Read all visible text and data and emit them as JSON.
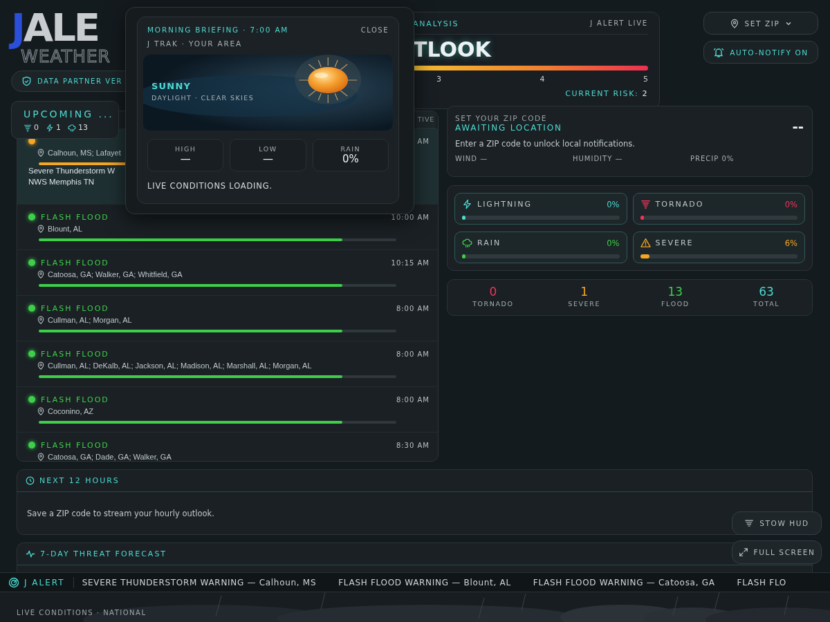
{
  "logo": {
    "initial": "J",
    "rest": "ALE",
    "subtitle": "WEATHER"
  },
  "partner_badge": {
    "label": "DATA PARTNER VER"
  },
  "risk_panel": {
    "title": "ANALYSIS",
    "source": "J ALERT LIVE",
    "heading": "TLOOK",
    "scale": [
      "3",
      "4",
      "5"
    ],
    "current_label": "CURRENT RISK:",
    "current_value": "2"
  },
  "header_buttons": [
    {
      "kind": "zip",
      "label": "SET ZIP",
      "on": false
    },
    {
      "kind": "notify",
      "label": "AUTO-NOTIFY ON",
      "on": true
    }
  ],
  "upcoming": {
    "title": "UPCOMING ...",
    "tab": "TIVE",
    "counts": [
      {
        "kind": "tornado",
        "value": "0"
      },
      {
        "kind": "lightning",
        "value": "1"
      },
      {
        "kind": "rain",
        "value": "13"
      }
    ],
    "alerts": [
      {
        "kind": "severe",
        "selected": true,
        "color": "#f5a623",
        "time": "AM",
        "location": "Calhoun, MS; Lafayet",
        "level": 0.85,
        "description": [
          "Severe Thunderstorm W",
          "NWS Memphis TN"
        ]
      },
      {
        "kind": "flood",
        "selected": false,
        "color": "#3ecf4a",
        "title": "FLASH FLOOD",
        "time": "10:00 AM",
        "location": "Blount, AL",
        "level": 0.85
      },
      {
        "kind": "flood",
        "selected": false,
        "color": "#3ecf4a",
        "title": "FLASH FLOOD",
        "time": "10:15 AM",
        "location": "Catoosa, GA; Walker, GA; Whitfield, GA",
        "level": 0.85
      },
      {
        "kind": "flood",
        "selected": false,
        "color": "#3ecf4a",
        "title": "FLASH FLOOD",
        "time": "8:00 AM",
        "location": "Cullman, AL; Morgan, AL",
        "level": 0.85
      },
      {
        "kind": "flood",
        "selected": false,
        "color": "#3ecf4a",
        "title": "FLASH FLOOD",
        "time": "8:00 AM",
        "location": "Cullman, AL; DeKalb, AL; Jackson, AL; Madison, AL; Marshall, AL; Morgan, AL",
        "level": 0.85
      },
      {
        "kind": "flood",
        "selected": false,
        "color": "#3ecf4a",
        "title": "FLASH FLOOD",
        "time": "8:00 AM",
        "location": "Coconino, AZ",
        "level": 0.85
      },
      {
        "kind": "flood",
        "selected": false,
        "color": "#3ecf4a",
        "title": "FLASH FLOOD",
        "time": "8:30 AM",
        "location": "Catoosa, GA; Dade, GA; Walker, GA"
      }
    ]
  },
  "briefing": {
    "title": "MORNING BRIEFING · 7:00 AM",
    "close": "CLOSE",
    "subtitle": "J TRAK · YOUR AREA",
    "condition": "SUNNY",
    "condition_detail": "DAYLIGHT · CLEAR SKIES",
    "stats": [
      {
        "label": "HIGH",
        "value": "—"
      },
      {
        "label": "LOW",
        "value": "—"
      },
      {
        "label": "RAIN",
        "value": "0%"
      }
    ],
    "status": "LIVE CONDITIONS LOADING."
  },
  "zip_card": {
    "label": "SET YOUR ZIP CODE",
    "status": "AWAITING LOCATION",
    "message": "Enter a ZIP code to unlock local notifications.",
    "temperature": "--",
    "readings": [
      "WIND —",
      "HUMIDITY —",
      "PRECIP 0%"
    ]
  },
  "threats": [
    {
      "kind": "lightning",
      "label": "LIGHTNING",
      "reading": "0%",
      "level": 0,
      "color": "#4dd9d0"
    },
    {
      "kind": "tornado",
      "label": "TORNADO",
      "reading": "0%",
      "level": 0,
      "color": "#f0365a"
    },
    {
      "kind": "rain",
      "label": "RAIN",
      "reading": "0%",
      "level": 0,
      "color": "#3ecf4a"
    },
    {
      "kind": "severe",
      "label": "SEVERE",
      "reading": "6%",
      "level": 0.06,
      "color": "#f5a623"
    }
  ],
  "totals": [
    {
      "value": "0",
      "label": "TORNADO",
      "color": "#f0365a"
    },
    {
      "value": "1",
      "label": "SEVERE",
      "color": "#f5a623"
    },
    {
      "value": "13",
      "label": "FLOOD",
      "color": "#3ecf4a"
    },
    {
      "value": "63",
      "label": "TOTAL",
      "color": "#4dd9d0"
    }
  ],
  "next_hours": {
    "title": "NEXT 12 HOURS",
    "message": "Save a ZIP code to stream your hourly outlook."
  },
  "forecast": {
    "title": "7-DAY THREAT FORECAST"
  },
  "hud_buttons": [
    {
      "kind": "stow",
      "label": "STOW HUD"
    },
    {
      "kind": "fullscreen",
      "label": "FULL SCREEN"
    }
  ],
  "ticker": {
    "brand": "J ALERT",
    "items": [
      "SEVERE THUNDERSTORM WARNING — Calhoun, MS",
      "FLASH FLOOD WARNING — Blount, AL",
      "FLASH FLOOD WARNING — Catoosa, GA",
      "FLASH FLO"
    ]
  },
  "footer": {
    "caption": "LIVE CONDITIONS · NATIONAL"
  }
}
